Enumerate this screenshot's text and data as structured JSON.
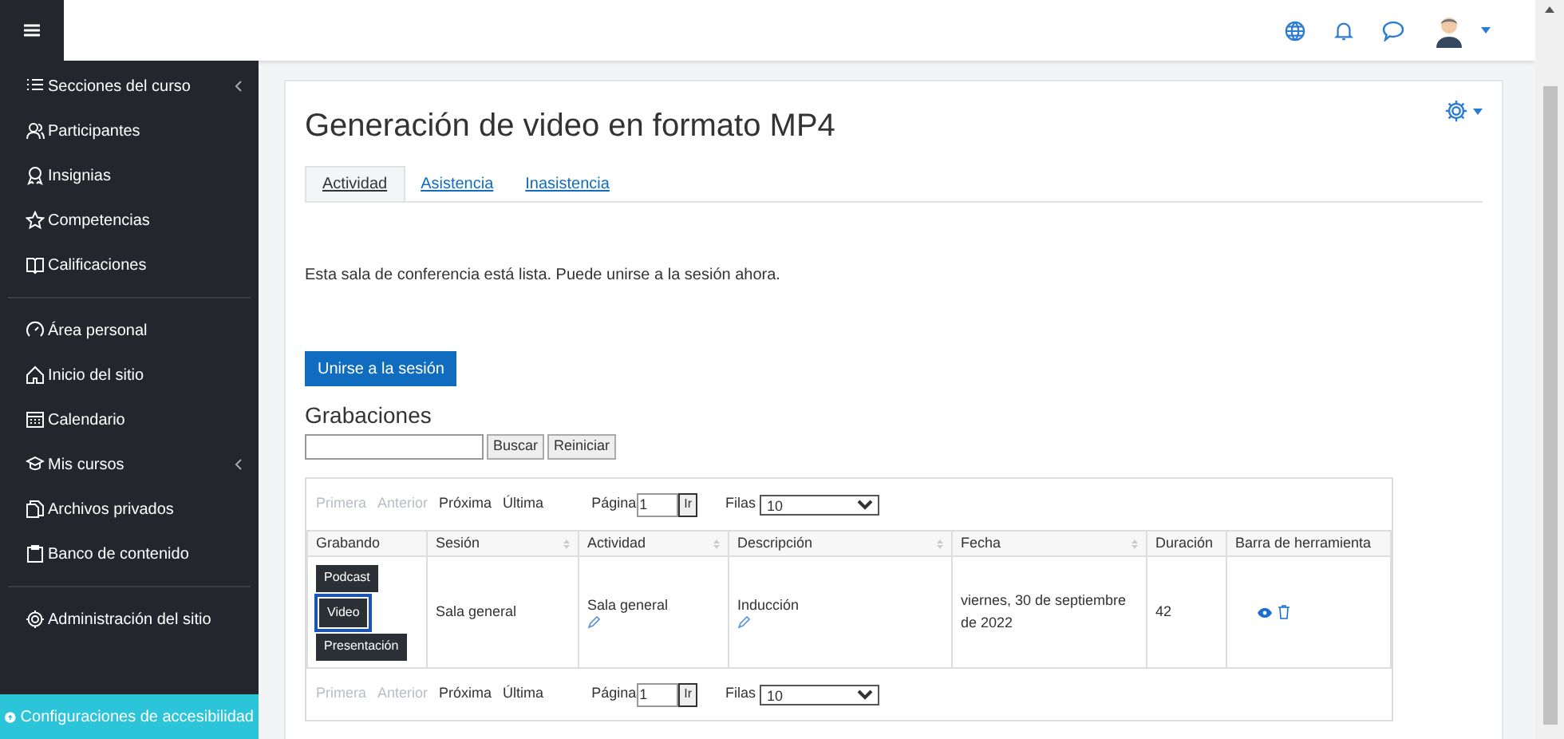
{
  "sidebar": {
    "groups": [
      {
        "items": [
          {
            "label": "Secciones del curso",
            "kind": "list",
            "expandable": true
          },
          {
            "label": "Participantes",
            "kind": "users",
            "expandable": false
          },
          {
            "label": "Insignias",
            "kind": "badge",
            "expandable": false
          },
          {
            "label": "Competencias",
            "kind": "star",
            "expandable": false
          },
          {
            "label": "Calificaciones",
            "kind": "book",
            "expandable": false
          }
        ]
      },
      {
        "items": [
          {
            "label": "Área personal",
            "kind": "gauge",
            "expandable": false
          },
          {
            "label": "Inicio del sitio",
            "kind": "home",
            "expandable": false
          },
          {
            "label": "Calendario",
            "kind": "calendar",
            "expandable": false
          },
          {
            "label": "Mis cursos",
            "kind": "cap",
            "expandable": true
          },
          {
            "label": "Archivos privados",
            "kind": "files",
            "expandable": false
          },
          {
            "label": "Banco de contenido",
            "kind": "clipboard",
            "expandable": false
          }
        ]
      },
      {
        "items": [
          {
            "label": "Administración del sitio",
            "kind": "gear",
            "expandable": false
          }
        ]
      }
    ],
    "accessibility": "Configuraciones de accesibilidad"
  },
  "page": {
    "title": "Generación de video en formato MP4",
    "tabs": [
      {
        "label": "Actividad",
        "selected": true
      },
      {
        "label": "Asistencia",
        "selected": false
      },
      {
        "label": "Inasistencia",
        "selected": false
      }
    ],
    "message": "Esta sala de conferencia está lista. Puede unirse a la sesión ahora.",
    "join_button": "Unirse a la sesión",
    "recordings": {
      "heading": "Grabaciones",
      "search_button": "Buscar",
      "reset_button": "Reiniciar",
      "pagers": [
        {
          "links": [
            {
              "label": "Primera",
              "disabled": true
            },
            {
              "label": "Anterior",
              "disabled": true
            },
            {
              "label": "Próxima",
              "disabled": false
            },
            {
              "label": "Última",
              "disabled": false
            }
          ],
          "page_label": "Página",
          "page_value": "1",
          "go_button": "Ir",
          "rows_label": "Filas",
          "rows_value": "10"
        },
        {
          "links": [
            {
              "label": "Primera",
              "disabled": true
            },
            {
              "label": "Anterior",
              "disabled": true
            },
            {
              "label": "Próxima",
              "disabled": false
            },
            {
              "label": "Última",
              "disabled": false
            }
          ],
          "page_label": "Página",
          "page_value": "1",
          "go_button": "Ir",
          "rows_label": "Filas",
          "rows_value": "10"
        }
      ],
      "columns": [
        {
          "label": "Grabando",
          "sortable": false
        },
        {
          "label": "Sesión",
          "sortable": true
        },
        {
          "label": "Actividad",
          "sortable": true
        },
        {
          "label": "Descripción",
          "sortable": true
        },
        {
          "label": "Fecha",
          "sortable": true
        },
        {
          "label": "Duración",
          "sortable": false
        },
        {
          "label": "Barra de herramienta",
          "sortable": false
        }
      ],
      "rows": [
        {
          "formats": [
            {
              "label": "Podcast",
              "selected": false
            },
            {
              "label": "Video",
              "selected": true
            },
            {
              "label": "Presentación",
              "selected": false
            }
          ],
          "session": "Sala general",
          "activity": "Sala general",
          "description": "Inducción",
          "date": "viernes, 30 de septiembre de 2022",
          "duration": "42"
        }
      ]
    }
  }
}
